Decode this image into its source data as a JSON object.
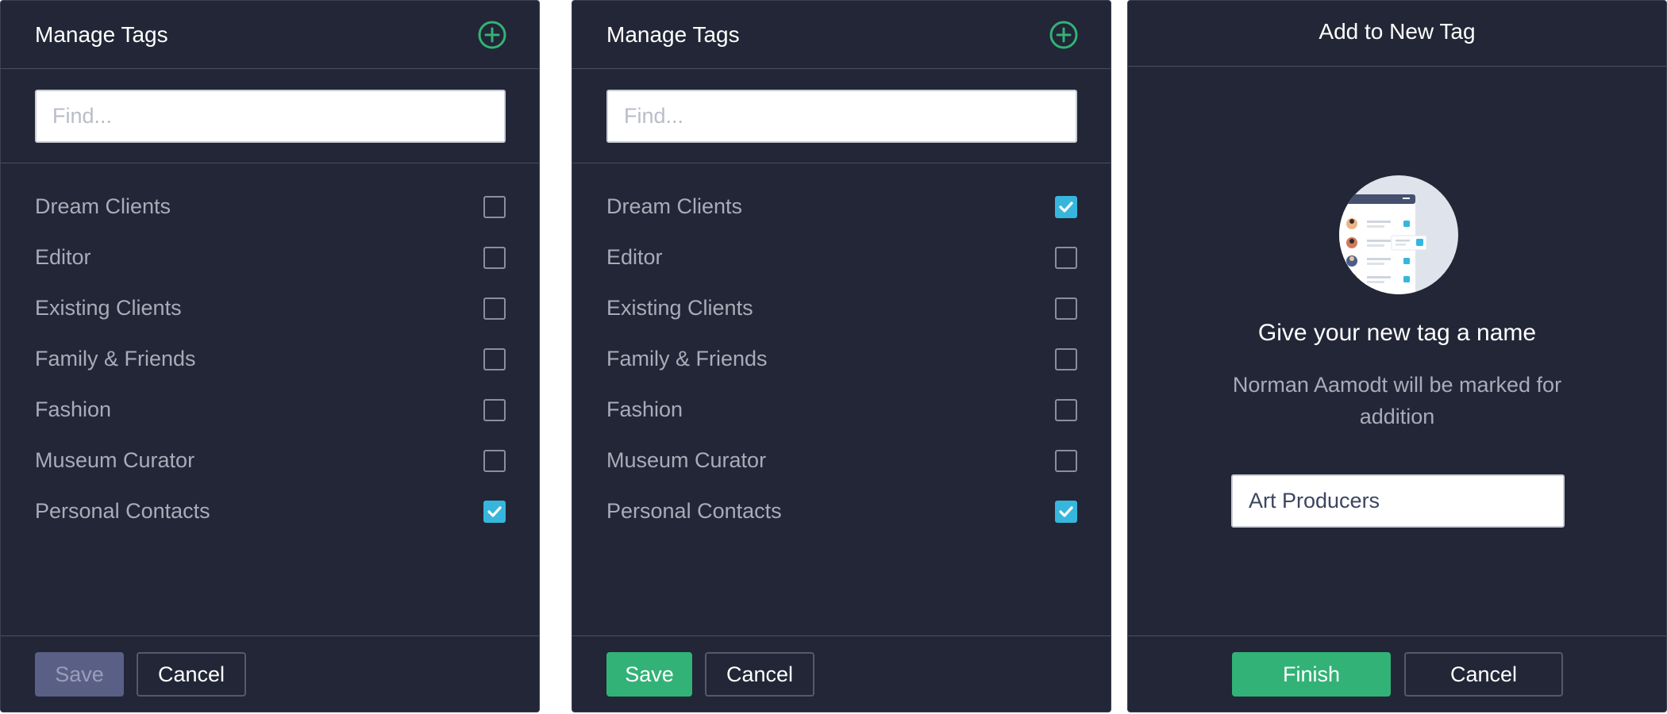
{
  "colors": {
    "panel_bg": "#222636",
    "accent_green": "#32b277",
    "checkbox_checked": "#37b6dd",
    "disabled_button": "#5a5f85"
  },
  "panel_a": {
    "title": "Manage Tags",
    "add_icon": "plus-circle-icon",
    "search": {
      "placeholder": "Find...",
      "value": ""
    },
    "tags": [
      {
        "label": "Dream Clients",
        "checked": false
      },
      {
        "label": "Editor",
        "checked": false
      },
      {
        "label": "Existing Clients",
        "checked": false
      },
      {
        "label": "Family & Friends",
        "checked": false
      },
      {
        "label": "Fashion",
        "checked": false
      },
      {
        "label": "Museum Curator",
        "checked": false
      },
      {
        "label": "Personal Contacts",
        "checked": true
      }
    ],
    "save_label": "Save",
    "save_enabled": false,
    "cancel_label": "Cancel"
  },
  "panel_b": {
    "title": "Manage Tags",
    "add_icon": "plus-circle-icon",
    "search": {
      "placeholder": "Find...",
      "value": ""
    },
    "tags": [
      {
        "label": "Dream Clients",
        "checked": true
      },
      {
        "label": "Editor",
        "checked": false
      },
      {
        "label": "Existing Clients",
        "checked": false
      },
      {
        "label": "Family & Friends",
        "checked": false
      },
      {
        "label": "Fashion",
        "checked": false
      },
      {
        "label": "Museum Curator",
        "checked": false
      },
      {
        "label": "Personal Contacts",
        "checked": true
      }
    ],
    "save_label": "Save",
    "save_enabled": true,
    "cancel_label": "Cancel"
  },
  "panel_c": {
    "title": "Add to New Tag",
    "illustration_icon": "contact-list-illustration",
    "heading": "Give your new tag a name",
    "description": "Norman Aamodt will be marked for addition",
    "name_input": {
      "value": "Art Producers"
    },
    "finish_label": "Finish",
    "cancel_label": "Cancel"
  }
}
